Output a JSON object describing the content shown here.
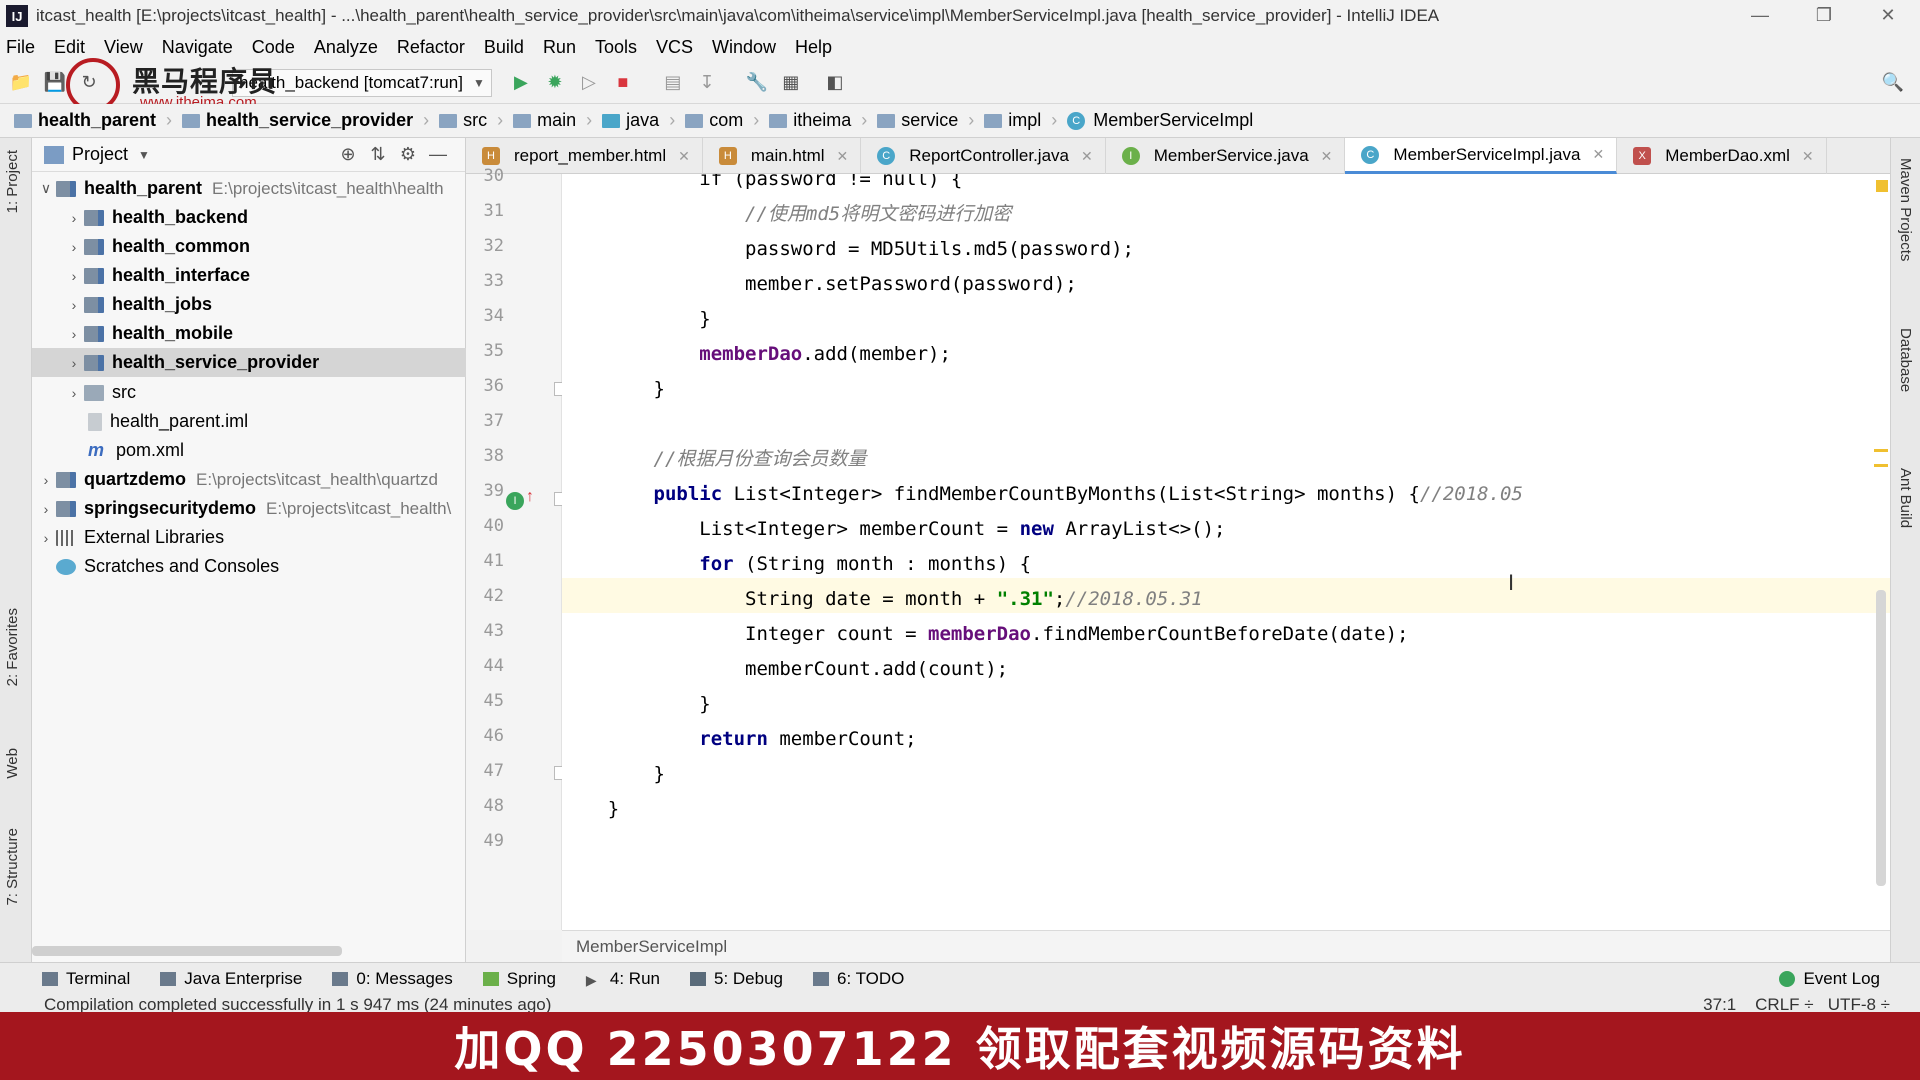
{
  "window": {
    "title": "itcast_health [E:\\projects\\itcast_health] - ...\\health_parent\\health_service_provider\\src\\main\\java\\com\\itheima\\service\\impl\\MemberServiceImpl.java [health_service_provider] - IntelliJ IDEA",
    "app_icon": "IJ"
  },
  "menu": [
    "File",
    "Edit",
    "View",
    "Navigate",
    "Code",
    "Analyze",
    "Refactor",
    "Build",
    "Run",
    "Tools",
    "VCS",
    "Window",
    "Help"
  ],
  "logo": {
    "brand": "黑马程序员",
    "url": "www.itheima.com"
  },
  "toolbar": {
    "run_config": "health_backend [tomcat7:run]"
  },
  "breadcrumb": [
    "health_parent",
    "health_service_provider",
    "src",
    "main",
    "java",
    "com",
    "itheima",
    "service",
    "impl",
    "MemberServiceImpl"
  ],
  "project_panel": {
    "title": "Project",
    "tree": [
      {
        "name": "health_parent",
        "path": "E:\\projects\\itcast_health\\health",
        "bold": true
      },
      {
        "name": "health_backend",
        "bold": true
      },
      {
        "name": "health_common",
        "bold": true
      },
      {
        "name": "health_interface",
        "bold": true
      },
      {
        "name": "health_jobs",
        "bold": true
      },
      {
        "name": "health_mobile",
        "bold": true
      },
      {
        "name": "health_service_provider",
        "bold": true
      },
      {
        "name": "src"
      },
      {
        "name": "health_parent.iml"
      },
      {
        "name": "pom.xml"
      },
      {
        "name": "quartzdemo",
        "path": "E:\\projects\\itcast_health\\quartzd",
        "bold": true
      },
      {
        "name": "springsecuritydemo",
        "path": "E:\\projects\\itcast_health\\",
        "bold": true
      },
      {
        "name": "External Libraries"
      },
      {
        "name": "Scratches and Consoles"
      }
    ]
  },
  "left_strip": [
    "1: Project",
    "2: Favorites",
    "Web",
    "7: Structure"
  ],
  "right_strip": [
    "Maven Projects",
    "Database",
    "Ant Build"
  ],
  "tabs": [
    {
      "label": "report_member.html",
      "icon": "H"
    },
    {
      "label": "main.html",
      "icon": "H"
    },
    {
      "label": "ReportController.java",
      "icon": "C"
    },
    {
      "label": "MemberService.java",
      "icon": "I"
    },
    {
      "label": "MemberServiceImpl.java",
      "icon": "C",
      "active": true
    },
    {
      "label": "MemberDao.xml",
      "icon": "X"
    }
  ],
  "editor": {
    "line_numbers": [
      "30",
      "31",
      "32",
      "33",
      "34",
      "35",
      "36",
      "37",
      "38",
      "39",
      "40",
      "41",
      "42",
      "43",
      "44",
      "45",
      "46",
      "47",
      "48",
      "49"
    ],
    "lines": [
      [
        "            if (password != null) {"
      ],
      [
        "                //使用md5将明文密码进行加密"
      ],
      [
        "                password = MD5Utils.md5(password);"
      ],
      [
        "                member.setPassword(password);"
      ],
      [
        "            }"
      ],
      [
        "            memberDao",
        ".add(member);"
      ],
      [
        "        }"
      ],
      [
        ""
      ],
      [
        "        //根据月份查询会员数量"
      ],
      [
        "        public",
        " List<Integer> findMemberCountByMonths(List<String> months) {",
        "//2018.05"
      ],
      [
        "            List<Integer> memberCount = ",
        "new",
        " ArrayList<>();"
      ],
      [
        "            for",
        " (String month : months) {"
      ],
      [
        "                String date = month + ",
        "\".31\"",
        ";",
        "//2018.05.31"
      ],
      [
        "                Integer count = ",
        "memberDao",
        ".findMemberCountBeforeDate(date);"
      ],
      [
        "                memberCount.add(count);"
      ],
      [
        "            }"
      ],
      [
        "            return",
        " memberCount;"
      ],
      [
        "        }"
      ],
      [
        "    }"
      ],
      [
        ""
      ]
    ],
    "footer_label": "MemberServiceImpl"
  },
  "bottom_tools": [
    "Terminal",
    "Java Enterprise",
    "0: Messages",
    "Spring",
    "4: Run",
    "5: Debug",
    "6: TODO"
  ],
  "event_log": "Event Log",
  "status": {
    "message": "Compilation completed successfully in 1 s 947 ms (24 minutes ago)",
    "position": "37:1",
    "line_sep": "CRLF ÷",
    "encoding": "UTF-8 ÷"
  },
  "banner": "加QQ 2250307122   领取配套视频源码资料",
  "colors": {
    "keyword": "#000080",
    "comment": "#808080",
    "string": "#008000",
    "field": "#660e7a",
    "banner": "#a4161e"
  }
}
